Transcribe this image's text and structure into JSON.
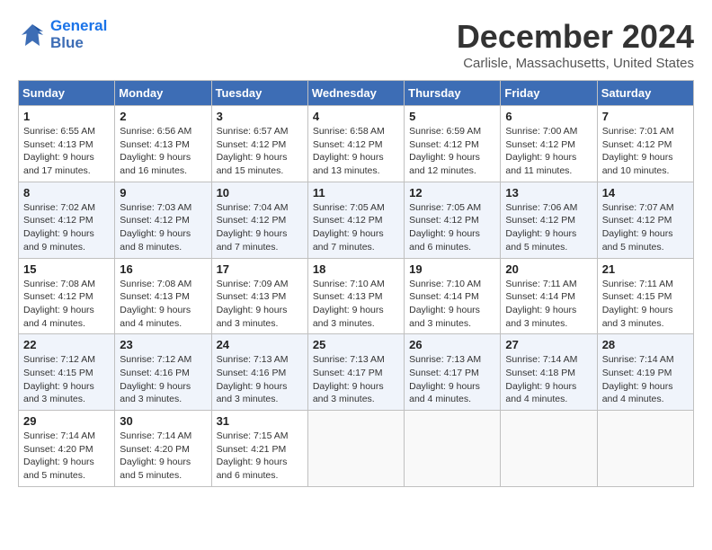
{
  "header": {
    "logo_line1": "General",
    "logo_line2": "Blue",
    "month_title": "December 2024",
    "location": "Carlisle, Massachusetts, United States"
  },
  "weekdays": [
    "Sunday",
    "Monday",
    "Tuesday",
    "Wednesday",
    "Thursday",
    "Friday",
    "Saturday"
  ],
  "weeks": [
    [
      {
        "day": "1",
        "info": "Sunrise: 6:55 AM\nSunset: 4:13 PM\nDaylight: 9 hours and 17 minutes."
      },
      {
        "day": "2",
        "info": "Sunrise: 6:56 AM\nSunset: 4:13 PM\nDaylight: 9 hours and 16 minutes."
      },
      {
        "day": "3",
        "info": "Sunrise: 6:57 AM\nSunset: 4:12 PM\nDaylight: 9 hours and 15 minutes."
      },
      {
        "day": "4",
        "info": "Sunrise: 6:58 AM\nSunset: 4:12 PM\nDaylight: 9 hours and 13 minutes."
      },
      {
        "day": "5",
        "info": "Sunrise: 6:59 AM\nSunset: 4:12 PM\nDaylight: 9 hours and 12 minutes."
      },
      {
        "day": "6",
        "info": "Sunrise: 7:00 AM\nSunset: 4:12 PM\nDaylight: 9 hours and 11 minutes."
      },
      {
        "day": "7",
        "info": "Sunrise: 7:01 AM\nSunset: 4:12 PM\nDaylight: 9 hours and 10 minutes."
      }
    ],
    [
      {
        "day": "8",
        "info": "Sunrise: 7:02 AM\nSunset: 4:12 PM\nDaylight: 9 hours and 9 minutes."
      },
      {
        "day": "9",
        "info": "Sunrise: 7:03 AM\nSunset: 4:12 PM\nDaylight: 9 hours and 8 minutes."
      },
      {
        "day": "10",
        "info": "Sunrise: 7:04 AM\nSunset: 4:12 PM\nDaylight: 9 hours and 7 minutes."
      },
      {
        "day": "11",
        "info": "Sunrise: 7:05 AM\nSunset: 4:12 PM\nDaylight: 9 hours and 7 minutes."
      },
      {
        "day": "12",
        "info": "Sunrise: 7:05 AM\nSunset: 4:12 PM\nDaylight: 9 hours and 6 minutes."
      },
      {
        "day": "13",
        "info": "Sunrise: 7:06 AM\nSunset: 4:12 PM\nDaylight: 9 hours and 5 minutes."
      },
      {
        "day": "14",
        "info": "Sunrise: 7:07 AM\nSunset: 4:12 PM\nDaylight: 9 hours and 5 minutes."
      }
    ],
    [
      {
        "day": "15",
        "info": "Sunrise: 7:08 AM\nSunset: 4:12 PM\nDaylight: 9 hours and 4 minutes."
      },
      {
        "day": "16",
        "info": "Sunrise: 7:08 AM\nSunset: 4:13 PM\nDaylight: 9 hours and 4 minutes."
      },
      {
        "day": "17",
        "info": "Sunrise: 7:09 AM\nSunset: 4:13 PM\nDaylight: 9 hours and 3 minutes."
      },
      {
        "day": "18",
        "info": "Sunrise: 7:10 AM\nSunset: 4:13 PM\nDaylight: 9 hours and 3 minutes."
      },
      {
        "day": "19",
        "info": "Sunrise: 7:10 AM\nSunset: 4:14 PM\nDaylight: 9 hours and 3 minutes."
      },
      {
        "day": "20",
        "info": "Sunrise: 7:11 AM\nSunset: 4:14 PM\nDaylight: 9 hours and 3 minutes."
      },
      {
        "day": "21",
        "info": "Sunrise: 7:11 AM\nSunset: 4:15 PM\nDaylight: 9 hours and 3 minutes."
      }
    ],
    [
      {
        "day": "22",
        "info": "Sunrise: 7:12 AM\nSunset: 4:15 PM\nDaylight: 9 hours and 3 minutes."
      },
      {
        "day": "23",
        "info": "Sunrise: 7:12 AM\nSunset: 4:16 PM\nDaylight: 9 hours and 3 minutes."
      },
      {
        "day": "24",
        "info": "Sunrise: 7:13 AM\nSunset: 4:16 PM\nDaylight: 9 hours and 3 minutes."
      },
      {
        "day": "25",
        "info": "Sunrise: 7:13 AM\nSunset: 4:17 PM\nDaylight: 9 hours and 3 minutes."
      },
      {
        "day": "26",
        "info": "Sunrise: 7:13 AM\nSunset: 4:17 PM\nDaylight: 9 hours and 4 minutes."
      },
      {
        "day": "27",
        "info": "Sunrise: 7:14 AM\nSunset: 4:18 PM\nDaylight: 9 hours and 4 minutes."
      },
      {
        "day": "28",
        "info": "Sunrise: 7:14 AM\nSunset: 4:19 PM\nDaylight: 9 hours and 4 minutes."
      }
    ],
    [
      {
        "day": "29",
        "info": "Sunrise: 7:14 AM\nSunset: 4:20 PM\nDaylight: 9 hours and 5 minutes."
      },
      {
        "day": "30",
        "info": "Sunrise: 7:14 AM\nSunset: 4:20 PM\nDaylight: 9 hours and 5 minutes."
      },
      {
        "day": "31",
        "info": "Sunrise: 7:15 AM\nSunset: 4:21 PM\nDaylight: 9 hours and 6 minutes."
      },
      {
        "day": "",
        "info": ""
      },
      {
        "day": "",
        "info": ""
      },
      {
        "day": "",
        "info": ""
      },
      {
        "day": "",
        "info": ""
      }
    ]
  ]
}
